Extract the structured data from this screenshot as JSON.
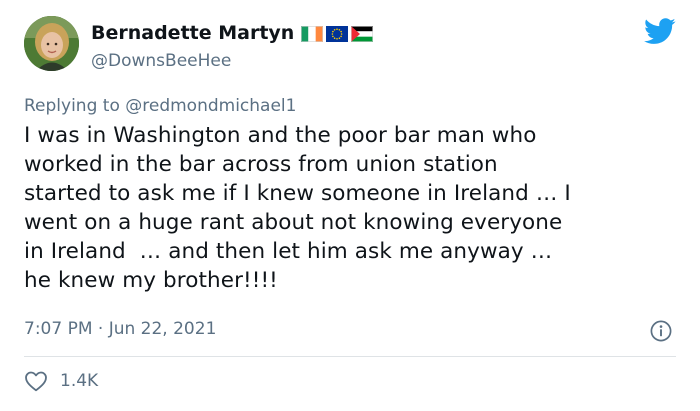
{
  "author": {
    "name": "Bernadette Martyn",
    "handle": "@DownsBeeHee",
    "flags": [
      "ireland-flag-icon",
      "eu-flag-icon",
      "palestine-flag-icon"
    ]
  },
  "reply": {
    "prefix": "Replying to ",
    "mention": "@redmondmichael1"
  },
  "tweet": {
    "text": "I was in Washington and the poor bar man who\nworked in the bar across from union station\nstarted to ask me if I knew someone in Ireland … I\nwent on a huge rant about not knowing everyone\nin Ireland  … and then let him ask me anyway …\nhe knew my brother!!!!",
    "timestamp": "7:07 PM · Jun 22, 2021"
  },
  "stats": {
    "likes": "1.4K"
  },
  "icons": {
    "brand": "twitter-bird-icon",
    "info": "info-icon",
    "like": "heart-icon"
  },
  "colors": {
    "brand": "#1da1f2",
    "muted": "#5b7083",
    "text": "#0f1419",
    "divider": "#dfe3e6"
  }
}
